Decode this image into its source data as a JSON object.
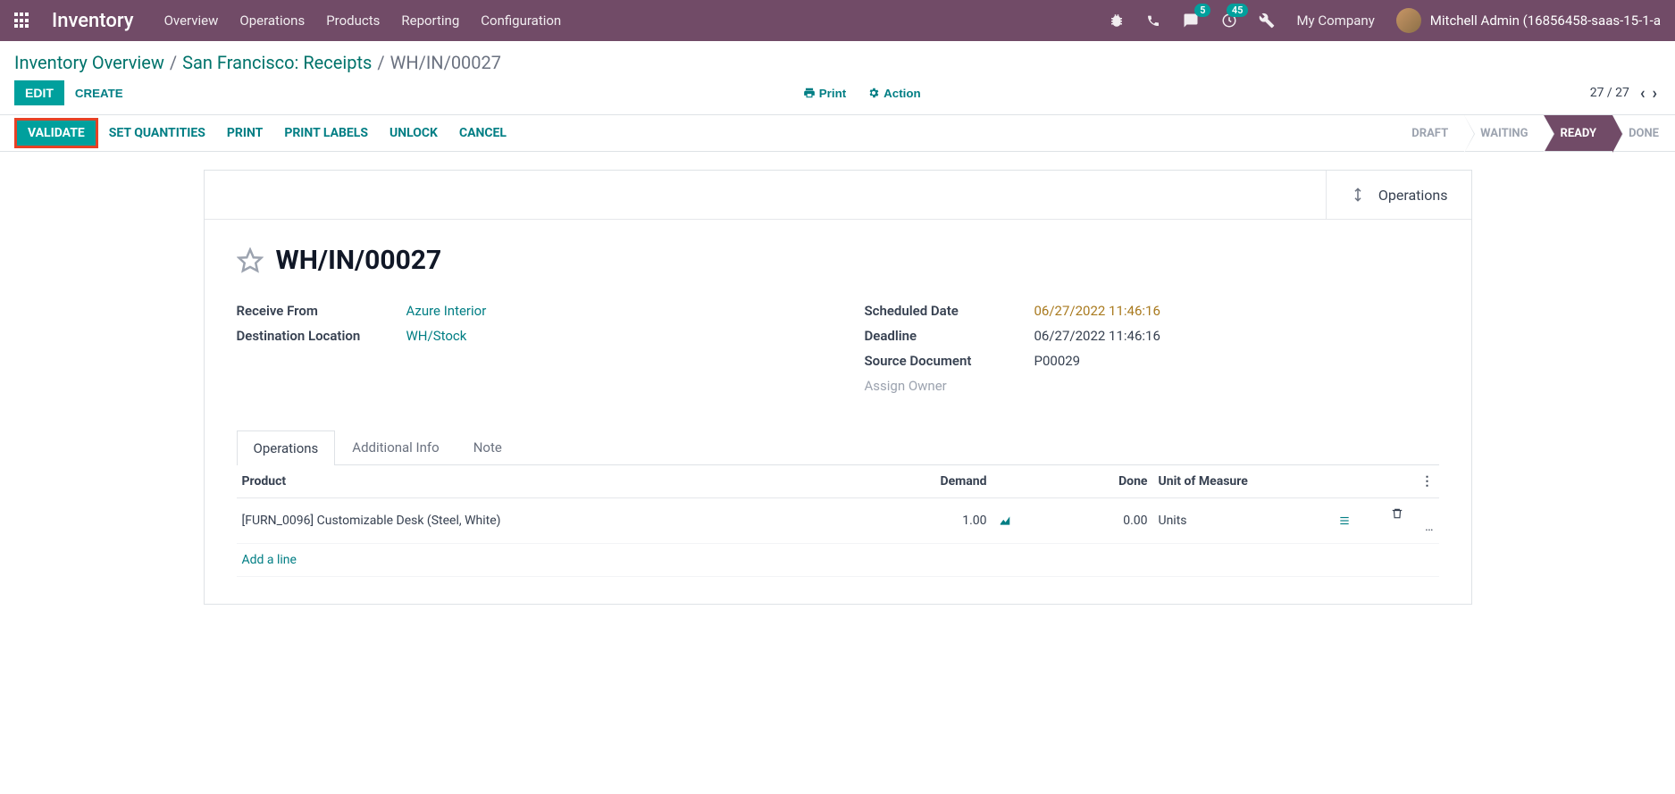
{
  "topnav": {
    "brand": "Inventory",
    "links": [
      "Overview",
      "Operations",
      "Products",
      "Reporting",
      "Configuration"
    ],
    "chat_badge": "5",
    "activity_badge": "45",
    "company": "My Company",
    "user": "Mitchell Admin (16856458-saas-15-1-a"
  },
  "breadcrumb": {
    "a": "Inventory Overview",
    "b": "San Francisco: Receipts",
    "cur": "WH/IN/00027"
  },
  "controls": {
    "edit": "EDIT",
    "create": "CREATE",
    "print": "Print",
    "action": "Action",
    "pager": "27 / 27"
  },
  "status": {
    "validate": "VALIDATE",
    "buttons": [
      "SET QUANTITIES",
      "PRINT",
      "PRINT LABELS",
      "UNLOCK",
      "CANCEL"
    ],
    "stages": [
      "DRAFT",
      "WAITING",
      "READY",
      "DONE"
    ],
    "active_stage": "READY"
  },
  "record": {
    "ops_btn": "Operations",
    "title": "WH/IN/00027",
    "left": {
      "receive_from_label": "Receive From",
      "receive_from": "Azure Interior",
      "dest_label": "Destination Location",
      "dest": "WH/Stock"
    },
    "right": {
      "sched_label": "Scheduled Date",
      "sched": "06/27/2022 11:46:16",
      "deadline_label": "Deadline",
      "deadline": "06/27/2022 11:46:16",
      "src_label": "Source Document",
      "src": "P00029",
      "owner": "Assign Owner"
    }
  },
  "tabs": [
    "Operations",
    "Additional Info",
    "Note"
  ],
  "table": {
    "headers": {
      "product": "Product",
      "demand": "Demand",
      "done": "Done",
      "uom": "Unit of Measure"
    },
    "row": {
      "product": "[FURN_0096] Customizable Desk (Steel, White)",
      "demand": "1.00",
      "done": "0.00",
      "uom": "Units"
    },
    "add_line": "Add a line"
  }
}
